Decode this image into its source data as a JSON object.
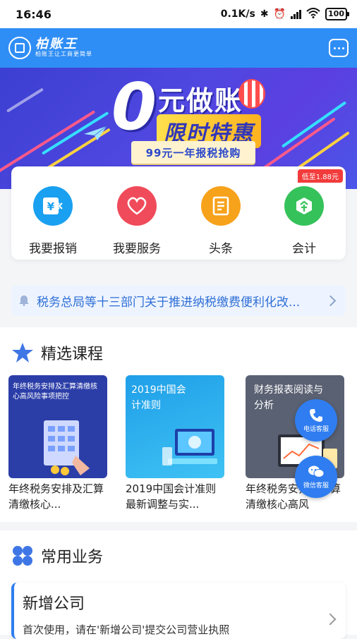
{
  "status_bar": {
    "time": "16:46",
    "speed": "0.1K/s",
    "battery": "100"
  },
  "header": {
    "brand": "柏账王",
    "tagline": "柏账王让工商更简单"
  },
  "banner": {
    "zero": "0",
    "line1": "元做账",
    "line2": "限时特惠",
    "tag": "99元一年报税抢购"
  },
  "quick_actions": {
    "promo_badge": "低至1.88元",
    "items": [
      {
        "label": "我要报销",
        "icon": "yen-icon",
        "color": "#1aa0f0"
      },
      {
        "label": "我要服务",
        "icon": "heart-icon",
        "color": "#f04b5a"
      },
      {
        "label": "头条",
        "icon": "document-icon",
        "color": "#f7a21b"
      },
      {
        "label": "会计",
        "icon": "leaf-badge-icon",
        "color": "#35c25a"
      }
    ]
  },
  "notice": {
    "text": "税务总局等十三部门关于推进纳税缴费便利化改..."
  },
  "courses": {
    "title": "精选课程",
    "items": [
      {
        "thumb_text": "年终税务安排及汇算清缴核心高风险事项把控",
        "title": "年终税务安排及汇算清缴核心..."
      },
      {
        "thumb_text": "2019中国会计准则",
        "title": "2019中国会计准则最新调整与实..."
      },
      {
        "thumb_text": "财务报表阅读与分析",
        "title": "年终税务安排及汇算清缴核心高风"
      }
    ]
  },
  "floating": {
    "phone": "电话客服",
    "wechat": "微信客服"
  },
  "business": {
    "title": "常用业务",
    "card_title": "新增公司",
    "card_desc": "首次使用，请在'新增公司'提交公司营业执照"
  }
}
